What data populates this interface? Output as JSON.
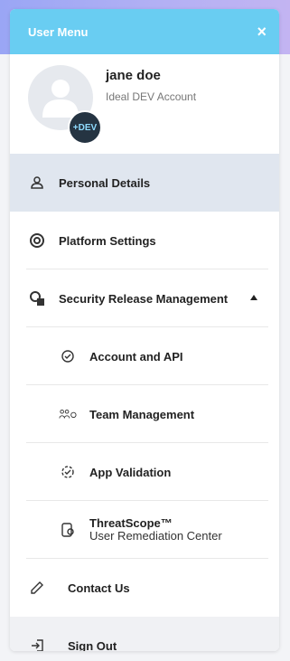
{
  "header": {
    "title": "User Menu",
    "close_icon": "×"
  },
  "profile": {
    "name": "jane doe",
    "account": "Ideal DEV Account",
    "badge": "+DEV"
  },
  "menu": {
    "personal": "Personal Details",
    "platform": "Platform Settings",
    "security": "Security Release Management",
    "sub": {
      "account_api": "Account and API",
      "team": "Team Management",
      "app_validation": "App Validation",
      "threatscope_title": "ThreatScope™",
      "threatscope_sub": "User Remediation Center"
    },
    "contact": "Contact Us",
    "signout": "Sign Out"
  }
}
